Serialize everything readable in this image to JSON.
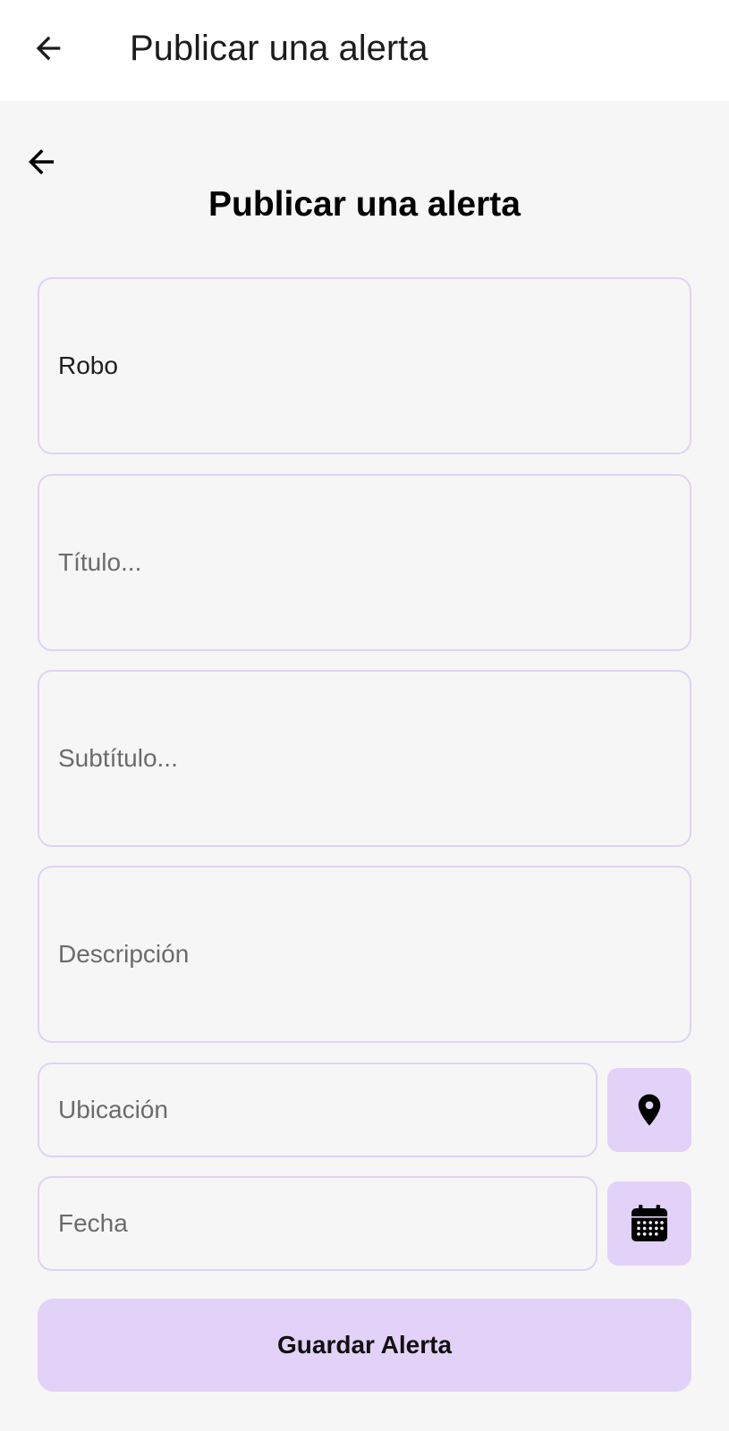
{
  "app_bar": {
    "title": "Publicar una alerta",
    "back_icon": "arrow-back-icon"
  },
  "content": {
    "back_icon": "arrow-back-icon",
    "title": "Publicar una alerta"
  },
  "form": {
    "category": {
      "value": "Robo"
    },
    "title": {
      "placeholder": "Título..."
    },
    "subtitle": {
      "placeholder": "Subtítulo..."
    },
    "description": {
      "placeholder": "Descripción"
    },
    "location": {
      "placeholder": "Ubicación",
      "button_icon": "location-pin-icon"
    },
    "date": {
      "placeholder": "Fecha",
      "button_icon": "calendar-icon"
    }
  },
  "save_button": {
    "label": "Guardar Alerta"
  },
  "colors": {
    "accent": "#e2d2f7",
    "field_border": "#e0d3f4",
    "background": "#f6f6f7",
    "app_bar": "#ffffff"
  }
}
